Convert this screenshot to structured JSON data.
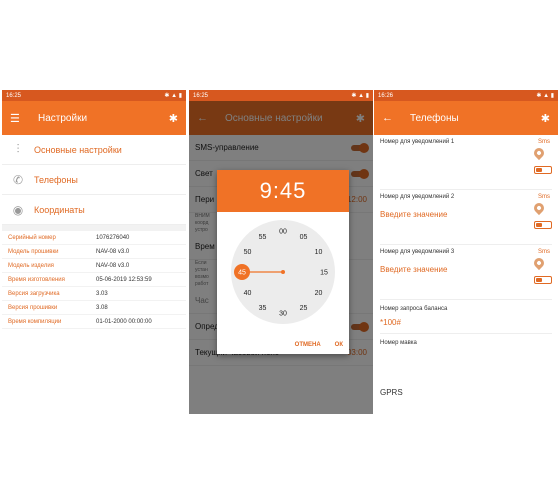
{
  "phone1": {
    "status_time": "16:25",
    "title": "Настройки",
    "menu": [
      {
        "label": "Основные настройки"
      },
      {
        "label": "Телефоны"
      },
      {
        "label": "Координаты"
      }
    ],
    "info": [
      {
        "key": "Серийный номер",
        "value": "1076276040"
      },
      {
        "key": "Модель прошивки",
        "value": "NAV-08 v3.0"
      },
      {
        "key": "Модель изделия",
        "value": "NAV-08 v3.0"
      },
      {
        "key": "Время изготовления",
        "value": "05-06-2019 12:53:59"
      },
      {
        "key": "Версия загрузчика",
        "value": "3.03"
      },
      {
        "key": "Версия прошивки",
        "value": "3.08"
      },
      {
        "key": "Время компиляции",
        "value": "01-01-2000 00:00:00"
      }
    ]
  },
  "phone2": {
    "status_time": "16:25",
    "title": "Основные настройки",
    "rows": {
      "sms": "SMS-управление",
      "light": "Свет",
      "period": "Пери",
      "period_value": "12:00",
      "attention": "ВНИМ",
      "attention_sub1": "коорд",
      "attention_sub2": "устро",
      "time": "Врем",
      "if_sub1": "Если",
      "if_sub2": "устан",
      "if_sub3": "возмо",
      "if_sub4": "работ",
      "clock_section": "Час",
      "auto": "Определять автоматически",
      "tz": "Текущий часовой пояс",
      "tz_value": "03:00"
    },
    "dialog": {
      "time": "9:45",
      "selected_minute": "45",
      "minutes": [
        "00",
        "05",
        "10",
        "15",
        "20",
        "25",
        "30",
        "35",
        "40",
        "45",
        "50",
        "55"
      ],
      "cancel": "ОТМЕНА",
      "ok": "ОК"
    }
  },
  "phone3": {
    "status_time": "16:26",
    "title": "Телефоны",
    "notify": [
      {
        "label": "Номер для уведомлений 1",
        "sms": "Sms",
        "value": ""
      },
      {
        "label": "Номер для уведомлений 2",
        "sms": "Sms",
        "value": "Введите значение"
      },
      {
        "label": "Номер для уведомлений 3",
        "sms": "Sms",
        "value": "Введите значение"
      }
    ],
    "balance_label": "Номер запроса баланса",
    "balance_value": "*100#",
    "master_label": "Номер мавка",
    "gprs": "GPRS"
  },
  "colors": {
    "accent": "#f07226",
    "status_bar": "#d7581f",
    "text_accent": "#e06a24"
  }
}
